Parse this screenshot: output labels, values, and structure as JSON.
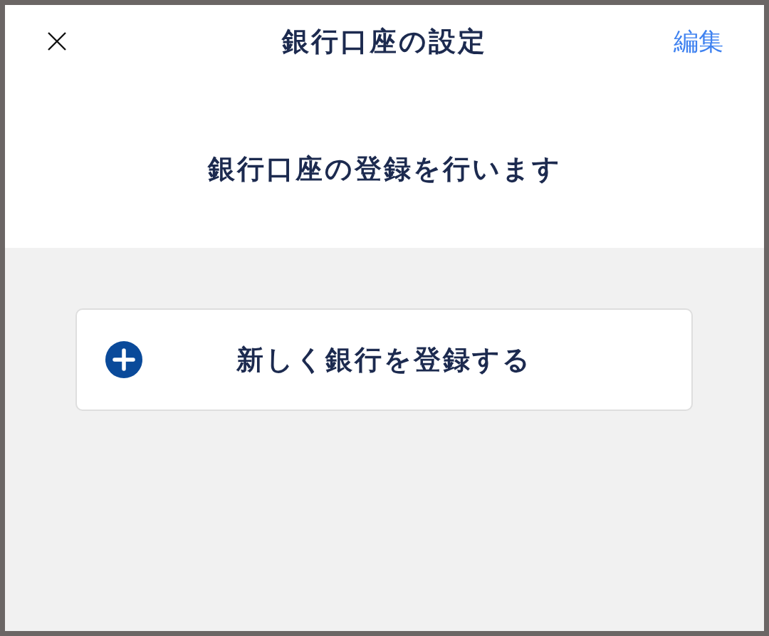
{
  "header": {
    "title": "銀行口座の設定",
    "edit_label": "編集"
  },
  "intro": {
    "text": "銀行口座の登録を行います"
  },
  "add_bank_button": {
    "label": "新しく銀行を登録する"
  }
}
